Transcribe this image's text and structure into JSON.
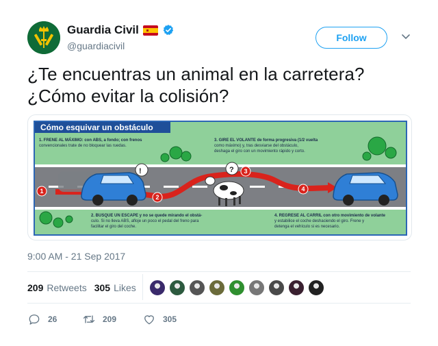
{
  "account": {
    "display_name": "Guardia Civil",
    "handle": "@guardiacivil",
    "verified": true,
    "flag": "spain-flag-emoji",
    "follow_label": "Follow"
  },
  "tweet": {
    "text_line1": "¿Te encuentras un animal en la carretera?",
    "text_line2": "¿Cómo evitar la colisión?",
    "timestamp": "9:00 AM - 21 Sep 2017"
  },
  "media": {
    "title": "Cómo esquivar un obstáculo",
    "step1": "1. FRENE AL MÁXIMO: con ABS, a fondo; con frenos convencionales trate de no bloquear las ruedas.",
    "step1_a": "1. FRENE AL MÁXIMO: con ABS, a fondo; con frenos",
    "step1_b": "convencionales trate de no bloquear las ruedas.",
    "step2_a": "2. BUSQUE UN ESCAPE y no se quede mirando el obstá-",
    "step2_b": "culo. Si no lleva ABS, afloje un poco el pedal del freno para",
    "step2_c": "facilitar el giro del coche.",
    "step3_a": "3. GIRE EL VOLANTE de forma progresiva (1/2 vuelta",
    "step3_b": "como máximo) y, tras desviarse del obstáculo,",
    "step3_c": "deshaga el giro con un movimiento rápido y corto.",
    "step4_a": "4. REGRESE AL CARRIL con otro movimiento de volante",
    "step4_b": "y estabilice el coche deshaciendo el giro. Frene y",
    "step4_c": "detenga el vehículo si es necesario.",
    "badges": [
      "1",
      "2",
      "3",
      "4"
    ]
  },
  "stats": {
    "retweets_count": "209",
    "retweets_label": "Retweets",
    "likes_count": "305",
    "likes_label": "Likes",
    "liker_colors": [
      "#3a2a6b",
      "#2d5a3f",
      "#555555",
      "#6b6b3a",
      "#2f8f2f",
      "#777777",
      "#4a4a4a",
      "#3a2030",
      "#222222"
    ]
  },
  "actions": {
    "replies": "26",
    "retweets": "209",
    "likes": "305"
  },
  "colors": {
    "accent": "#1da1f2",
    "muted": "#657786",
    "brand_green": "#0f6b37"
  }
}
